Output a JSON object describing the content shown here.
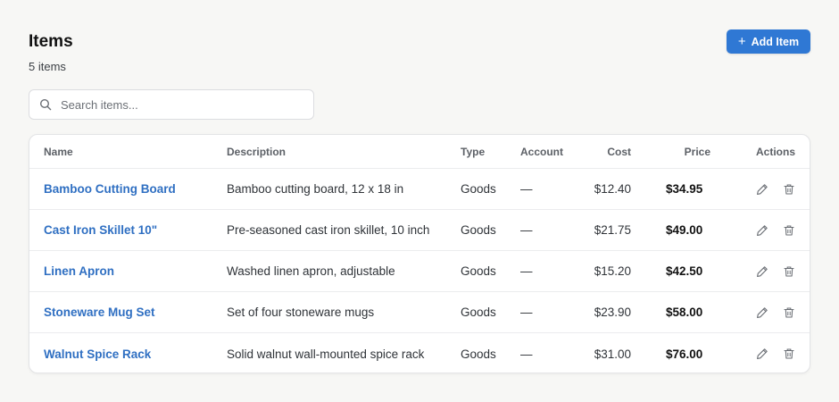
{
  "header": {
    "title": "Items",
    "count_text": "5 items",
    "add_button_label": "Add Item"
  },
  "search": {
    "placeholder": "Search items...",
    "value": ""
  },
  "table": {
    "columns": {
      "name": "Name",
      "description": "Description",
      "type": "Type",
      "account": "Account",
      "cost": "Cost",
      "price": "Price",
      "actions": "Actions"
    },
    "rows": [
      {
        "name": "Bamboo Cutting Board",
        "description": "Bamboo cutting board, 12 x 18 in",
        "type": "Goods",
        "account": "—",
        "cost": "$12.40",
        "price": "$34.95"
      },
      {
        "name": "Cast Iron Skillet 10\"",
        "description": "Pre-seasoned cast iron skillet, 10 inch",
        "type": "Goods",
        "account": "—",
        "cost": "$21.75",
        "price": "$49.00"
      },
      {
        "name": "Linen Apron",
        "description": "Washed linen apron, adjustable",
        "type": "Goods",
        "account": "—",
        "cost": "$15.20",
        "price": "$42.50"
      },
      {
        "name": "Stoneware Mug Set",
        "description": "Set of four stoneware mugs",
        "type": "Goods",
        "account": "—",
        "cost": "$23.90",
        "price": "$58.00"
      },
      {
        "name": "Walnut Spice Rack",
        "description": "Solid walnut wall-mounted spice rack",
        "type": "Goods",
        "account": "—",
        "cost": "$31.00",
        "price": "$76.00"
      }
    ]
  },
  "icons": {
    "search": "search-icon",
    "plus": "plus-icon",
    "edit": "pencil-icon",
    "delete": "trash-icon"
  },
  "colors": {
    "accent": "#2f78d4",
    "link": "#2f6fc2",
    "background": "#f7f7f5"
  }
}
